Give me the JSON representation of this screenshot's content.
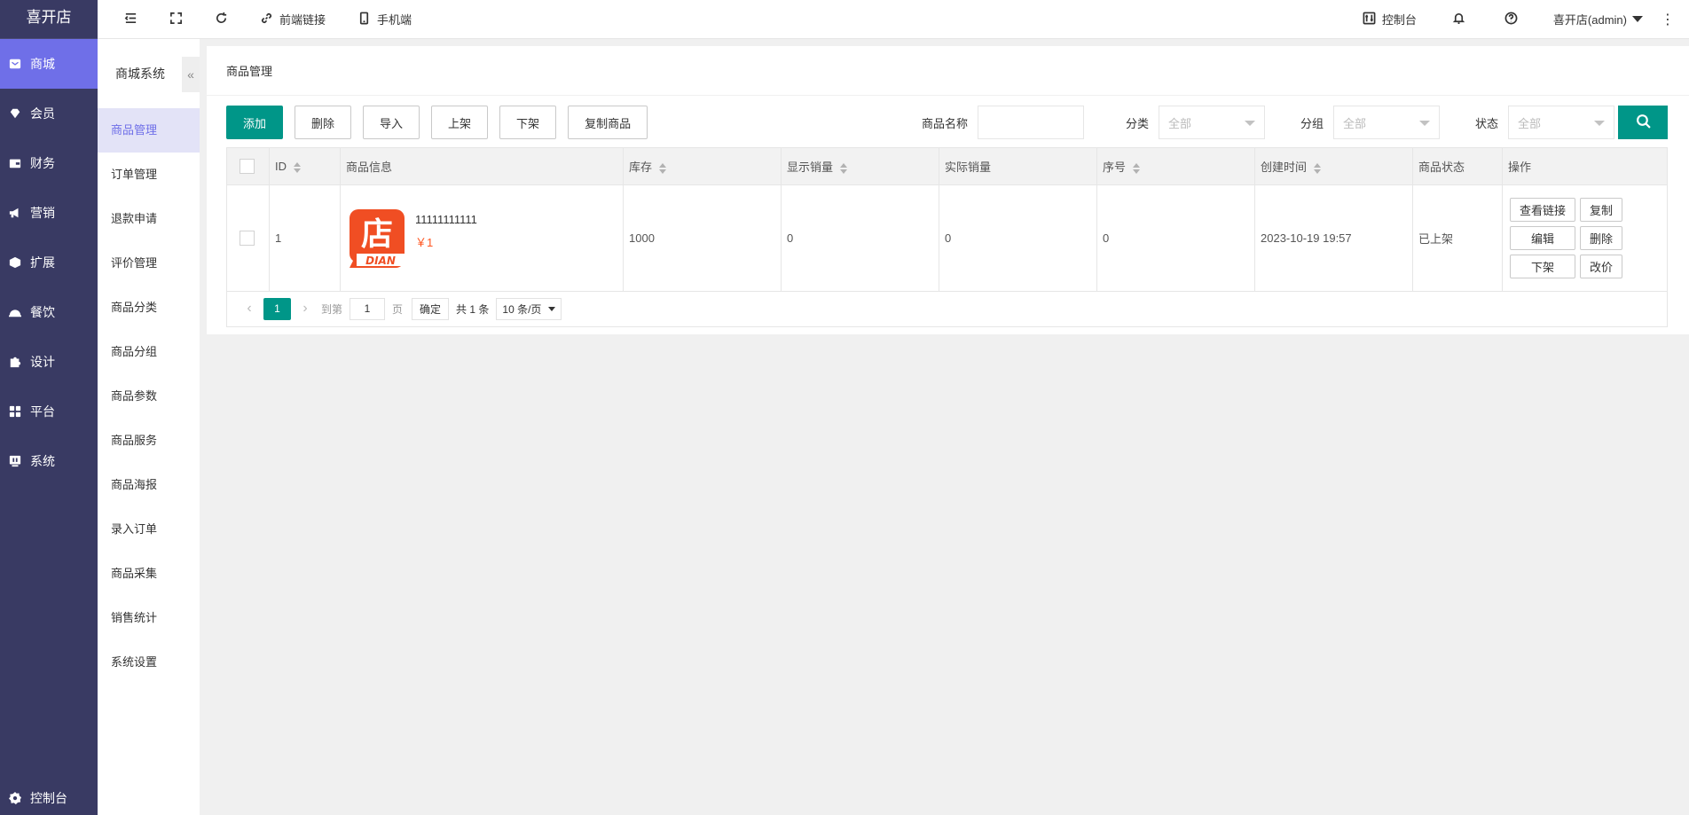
{
  "app": {
    "title": "喜开店"
  },
  "sidebar": {
    "items": [
      {
        "label": "商城",
        "icon": "shop-icon"
      },
      {
        "label": "会员",
        "icon": "gem-icon"
      },
      {
        "label": "财务",
        "icon": "wallet-icon"
      },
      {
        "label": "营销",
        "icon": "megaphone-icon"
      },
      {
        "label": "扩展",
        "icon": "cube-icon"
      },
      {
        "label": "餐饮",
        "icon": "dish-icon"
      },
      {
        "label": "设计",
        "icon": "puzzle-icon"
      },
      {
        "label": "平台",
        "icon": "grid-icon"
      },
      {
        "label": "系统",
        "icon": "monitor-icon"
      }
    ],
    "bottom_label": "控制台"
  },
  "subnav": {
    "title": "商城系统",
    "collapse_icon": "«",
    "items": [
      "商品管理",
      "订单管理",
      "退款申请",
      "评价管理",
      "商品分类",
      "商品分组",
      "商品参数",
      "商品服务",
      "商品海报",
      "录入订单",
      "商品采集",
      "销售统计",
      "系统设置"
    ]
  },
  "header": {
    "front_link": "前端链接",
    "mobile": "手机端",
    "console": "控制台",
    "user": "喜开店(admin)"
  },
  "page": {
    "title": "商品管理"
  },
  "toolbar": {
    "add": "添加",
    "delete": "删除",
    "import": "导入",
    "on_shelf": "上架",
    "off_shelf": "下架",
    "copy": "复制商品"
  },
  "filters": {
    "name_label": "商品名称",
    "category_label": "分类",
    "category_value": "全部",
    "group_label": "分组",
    "group_value": "全部",
    "status_label": "状态",
    "status_value": "全部"
  },
  "table": {
    "headers": [
      "ID",
      "商品信息",
      "库存",
      "显示销量",
      "实际销量",
      "序号",
      "创建时间",
      "商品状态",
      "操作"
    ],
    "rows": [
      {
        "id": "1",
        "name": "11111111111",
        "price": "￥1",
        "stock": "1000",
        "display_sales": "0",
        "actual_sales": "0",
        "sort": "0",
        "created": "2023-10-19 19:57",
        "status": "已上架",
        "ops": [
          "查看链接",
          "复制",
          "编辑",
          "删除",
          "下架",
          "改价"
        ]
      }
    ]
  },
  "product_image": {
    "char": "店",
    "text": "DIAN",
    "color": "#f04e23"
  },
  "pagination": {
    "current": "1",
    "goto_label": "到第",
    "goto_value": "1",
    "page_suffix": "页",
    "confirm": "确定",
    "total": "共 1 条",
    "page_size": "10 条/页"
  },
  "colors": {
    "sidebar": "#393a63",
    "accent": "#6f6fe8",
    "primary": "#009688",
    "price": "#ff5722",
    "status_on": "#009a29"
  }
}
